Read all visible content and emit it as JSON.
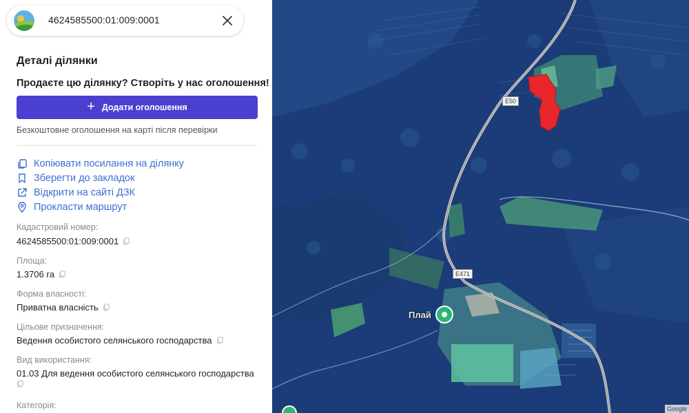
{
  "search": {
    "value": "4624585500:01:009:0001"
  },
  "details": {
    "title": "Деталі ділянки",
    "promo": "Продаєте цю ділянку? Створіть у нас оголошення!",
    "add_button": "Додати оголошення",
    "note": "Безкоштовне оголошення на карті після перевірки"
  },
  "actions": [
    {
      "label": "Копіювати посилання на ділянку",
      "icon": "copy-icon"
    },
    {
      "label": "Зберегти до закладок",
      "icon": "bookmark-icon"
    },
    {
      "label": "Відкрити на сайті ДЗК",
      "icon": "external-link-icon"
    },
    {
      "label": "Прокласти маршрут",
      "icon": "location-pin-icon"
    }
  ],
  "fields": [
    {
      "label": "Кадастровий номер:",
      "value": "4624585500:01:009:0001"
    },
    {
      "label": "Площа:",
      "value": "1.3706 га"
    },
    {
      "label": "Форма власності:",
      "value": "Приватна власність"
    },
    {
      "label": "Цільове призначення:",
      "value": "Ведення особистого селянського господарства"
    },
    {
      "label": "Вид використання:",
      "value": "01.03 Для ведення особистого селянського господарства"
    },
    {
      "label": "Категорія:",
      "value": ""
    }
  ],
  "map": {
    "road_labels": [
      "E50",
      "E471"
    ],
    "place_label": "Плай",
    "attribution": "Google",
    "colors": {
      "primary": "#4a3fcf",
      "link": "#3c6fd1",
      "parcel": "#e8262b",
      "pin": "#2bb673",
      "overlay": "#1c3f7e"
    }
  }
}
